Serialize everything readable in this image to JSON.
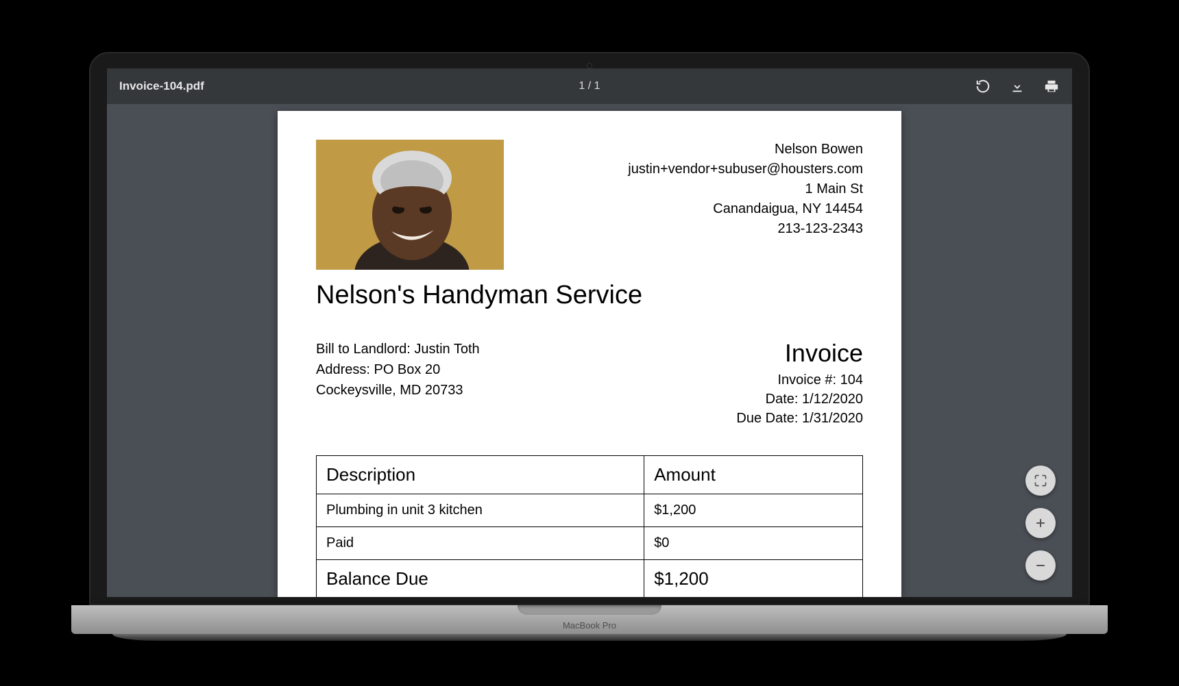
{
  "viewer": {
    "filename": "Invoice-104.pdf",
    "page_indicator": "1 / 1"
  },
  "device": {
    "label": "MacBook Pro"
  },
  "invoice": {
    "company_name": "Nelson's Handyman Service",
    "vendor": {
      "name": "Nelson Bowen",
      "email": "justin+vendor+subuser@housters.com",
      "street": "1 Main St",
      "city_state_zip": "Canandaigua, NY 14454",
      "phone": "213-123-2343"
    },
    "bill_to": {
      "line1": "Bill to Landlord: Justin Toth",
      "line2": "Address: PO Box 20",
      "line3": "Cockeysville, MD 20733"
    },
    "meta": {
      "title": "Invoice",
      "number": "Invoice #: 104",
      "date": "Date: 1/12/2020",
      "due_date": "Due Date: 1/31/2020"
    },
    "table": {
      "headers": {
        "description": "Description",
        "amount": "Amount"
      },
      "rows": [
        {
          "description": "Plumbing in unit 3 kitchen",
          "amount": "$1,200"
        },
        {
          "description": "Paid",
          "amount": "$0"
        }
      ],
      "balance": {
        "label": "Balance Due",
        "amount": "$1,200"
      }
    }
  }
}
